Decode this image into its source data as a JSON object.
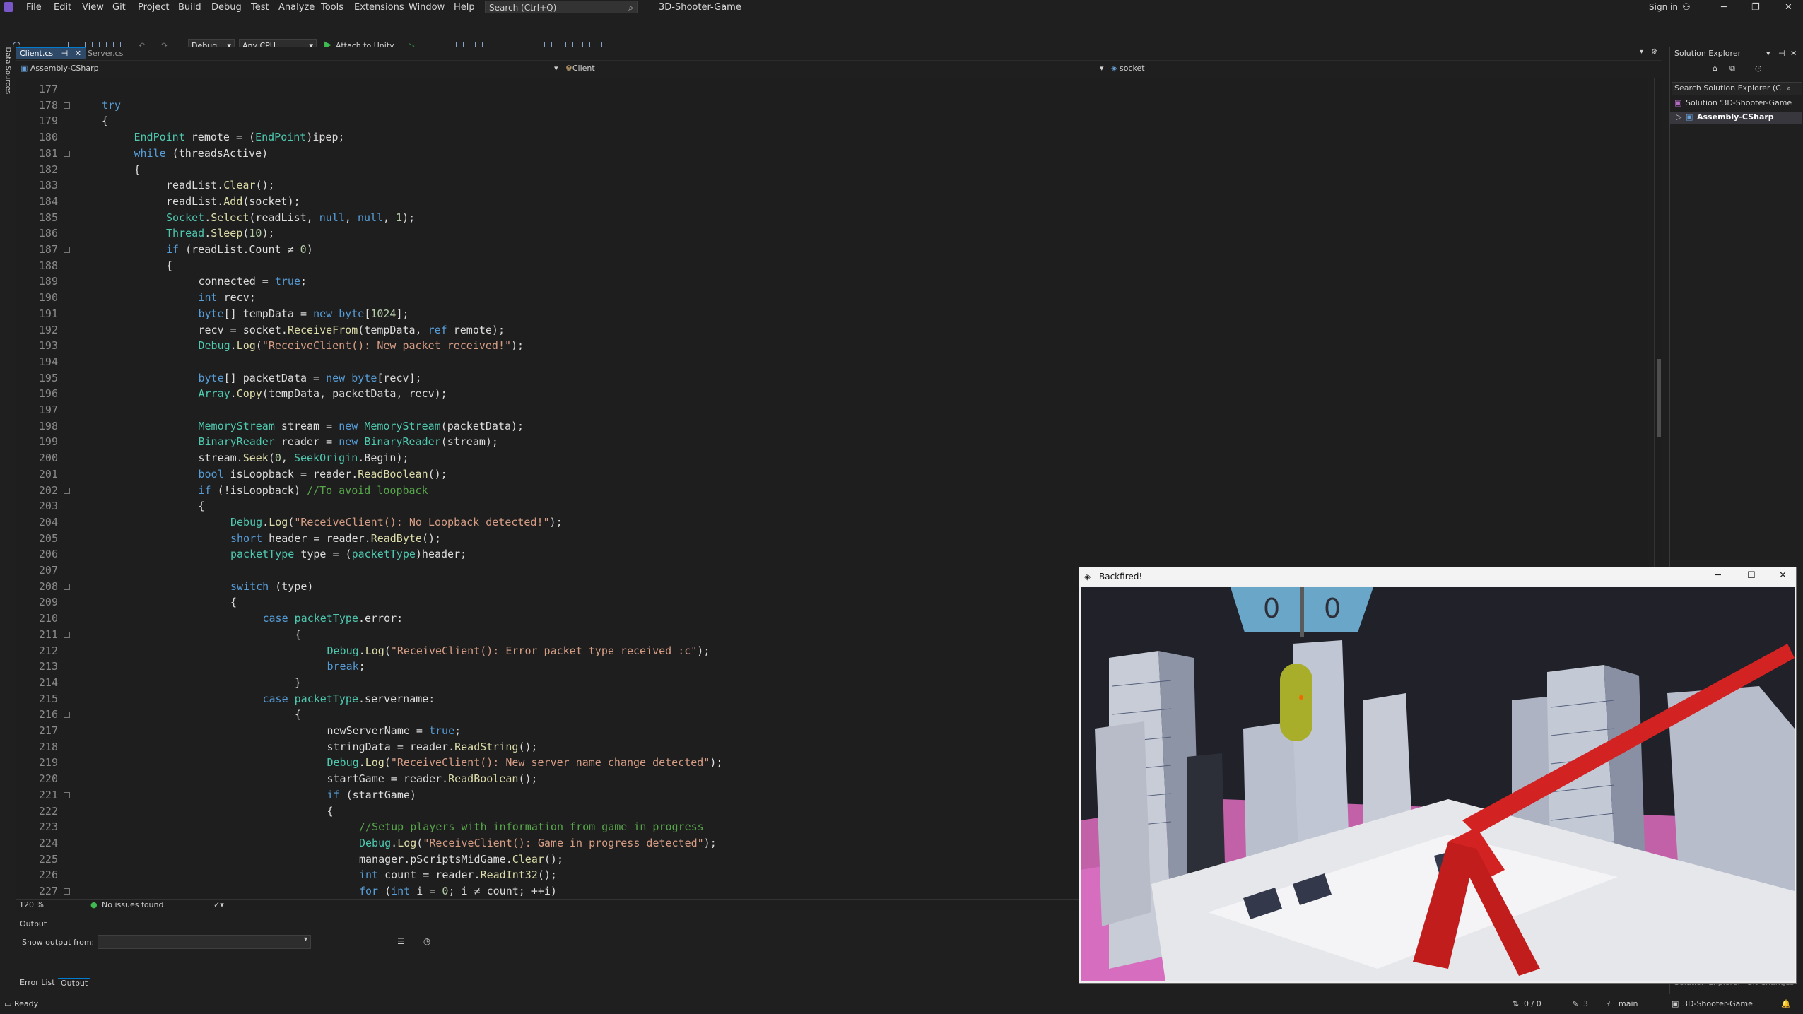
{
  "menu": {
    "items": [
      "File",
      "Edit",
      "View",
      "Git",
      "Project",
      "Build",
      "Debug",
      "Test",
      "Analyze",
      "Tools",
      "Extensions",
      "Window",
      "Help"
    ],
    "search_placeholder": "Search (Ctrl+Q)",
    "solution_title": "3D-Shooter-Game",
    "sign_in": "Sign in"
  },
  "toolbar": {
    "config": "Debug",
    "platform": "Any CPU",
    "attach": "Attach to Unity"
  },
  "tabs": [
    {
      "label": "Client.cs"
    },
    {
      "label": "Server.cs"
    }
  ],
  "navbar": {
    "project": "Assembly-CSharp",
    "class": "Client",
    "member": "socket"
  },
  "left_strip": {
    "label": "Data Sources"
  },
  "editor": {
    "zoom": "120 %",
    "issues": "No issues found",
    "lines": [
      {
        "n": "177",
        "indent": 0,
        "parts": []
      },
      {
        "n": "178",
        "indent": 2,
        "parts": [
          [
            "kw",
            "try"
          ]
        ]
      },
      {
        "n": "179",
        "indent": 2,
        "parts": [
          [
            "",
            "{"
          ]
        ]
      },
      {
        "n": "180",
        "indent": 3,
        "parts": [
          [
            "ty",
            "EndPoint"
          ],
          [
            "",
            " remote = ("
          ],
          [
            "ty",
            "EndPoint"
          ],
          [
            "",
            ")ipep;"
          ]
        ]
      },
      {
        "n": "181",
        "indent": 3,
        "parts": [
          [
            "kw",
            "while"
          ],
          [
            "",
            " (threadsActive)"
          ]
        ]
      },
      {
        "n": "182",
        "indent": 3,
        "parts": [
          [
            "",
            "{"
          ]
        ]
      },
      {
        "n": "183",
        "indent": 4,
        "parts": [
          [
            "",
            "readList."
          ],
          [
            "mt",
            "Clear"
          ],
          [
            "",
            "();"
          ]
        ]
      },
      {
        "n": "184",
        "indent": 4,
        "parts": [
          [
            "",
            "readList."
          ],
          [
            "mt",
            "Add"
          ],
          [
            "",
            "(socket);"
          ]
        ]
      },
      {
        "n": "185",
        "indent": 4,
        "parts": [
          [
            "ty",
            "Socket"
          ],
          [
            "",
            "."
          ],
          [
            "mt",
            "Select"
          ],
          [
            "",
            "(readList, "
          ],
          [
            "kw",
            "null"
          ],
          [
            "",
            ", "
          ],
          [
            "kw",
            "null"
          ],
          [
            "",
            ", "
          ],
          [
            "nm",
            "1"
          ],
          [
            "",
            ");"
          ]
        ]
      },
      {
        "n": "186",
        "indent": 4,
        "parts": [
          [
            "ty",
            "Thread"
          ],
          [
            "",
            "."
          ],
          [
            "mt",
            "Sleep"
          ],
          [
            "",
            "("
          ],
          [
            "nm",
            "10"
          ],
          [
            "",
            ");"
          ]
        ]
      },
      {
        "n": "187",
        "indent": 4,
        "parts": [
          [
            "kw",
            "if"
          ],
          [
            "",
            " (readList.Count ≠ "
          ],
          [
            "nm",
            "0"
          ],
          [
            "",
            ")"
          ]
        ]
      },
      {
        "n": "188",
        "indent": 4,
        "parts": [
          [
            "",
            "{"
          ]
        ]
      },
      {
        "n": "189",
        "indent": 5,
        "parts": [
          [
            "",
            "connected = "
          ],
          [
            "kw",
            "true"
          ],
          [
            "",
            ";"
          ]
        ]
      },
      {
        "n": "190",
        "indent": 5,
        "parts": [
          [
            "kw",
            "int"
          ],
          [
            "",
            " recv;"
          ]
        ]
      },
      {
        "n": "191",
        "indent": 5,
        "parts": [
          [
            "kw",
            "byte"
          ],
          [
            "",
            "[] tempData = "
          ],
          [
            "kw",
            "new"
          ],
          [
            "",
            " "
          ],
          [
            "kw",
            "byte"
          ],
          [
            "",
            "["
          ],
          [
            "nm",
            "1024"
          ],
          [
            "",
            "];"
          ]
        ]
      },
      {
        "n": "192",
        "indent": 5,
        "parts": [
          [
            "",
            "recv = socket."
          ],
          [
            "mt",
            "ReceiveFrom"
          ],
          [
            "",
            "(tempData, "
          ],
          [
            "kw",
            "ref"
          ],
          [
            "",
            " remote);"
          ]
        ]
      },
      {
        "n": "193",
        "indent": 5,
        "parts": [
          [
            "ty",
            "Debug"
          ],
          [
            "",
            "."
          ],
          [
            "mt",
            "Log"
          ],
          [
            "",
            "("
          ],
          [
            "st",
            "\"ReceiveClient(): New packet received!\""
          ],
          [
            "",
            ");"
          ]
        ]
      },
      {
        "n": "194",
        "indent": 0,
        "parts": []
      },
      {
        "n": "195",
        "indent": 5,
        "parts": [
          [
            "kw",
            "byte"
          ],
          [
            "",
            "[] packetData = "
          ],
          [
            "kw",
            "new"
          ],
          [
            "",
            " "
          ],
          [
            "kw",
            "byte"
          ],
          [
            "",
            "[recv];"
          ]
        ]
      },
      {
        "n": "196",
        "indent": 5,
        "parts": [
          [
            "ty",
            "Array"
          ],
          [
            "",
            "."
          ],
          [
            "mt",
            "Copy"
          ],
          [
            "",
            "(tempData, packetData, recv);"
          ]
        ]
      },
      {
        "n": "197",
        "indent": 0,
        "parts": []
      },
      {
        "n": "198",
        "indent": 5,
        "parts": [
          [
            "ty",
            "MemoryStream"
          ],
          [
            "",
            " stream = "
          ],
          [
            "kw",
            "new"
          ],
          [
            "",
            " "
          ],
          [
            "ty",
            "MemoryStream"
          ],
          [
            "",
            "(packetData);"
          ]
        ]
      },
      {
        "n": "199",
        "indent": 5,
        "parts": [
          [
            "ty",
            "BinaryReader"
          ],
          [
            "",
            " reader = "
          ],
          [
            "kw",
            "new"
          ],
          [
            "",
            " "
          ],
          [
            "ty",
            "BinaryReader"
          ],
          [
            "",
            "(stream);"
          ]
        ]
      },
      {
        "n": "200",
        "indent": 5,
        "parts": [
          [
            "",
            "stream."
          ],
          [
            "mt",
            "Seek"
          ],
          [
            "",
            "("
          ],
          [
            "nm",
            "0"
          ],
          [
            "",
            ", "
          ],
          [
            "ty",
            "SeekOrigin"
          ],
          [
            "",
            ".Begin);"
          ]
        ]
      },
      {
        "n": "201",
        "indent": 5,
        "parts": [
          [
            "kw",
            "bool"
          ],
          [
            "",
            " isLoopback = reader."
          ],
          [
            "mt",
            "ReadBoolean"
          ],
          [
            "",
            "();"
          ]
        ]
      },
      {
        "n": "202",
        "indent": 5,
        "parts": [
          [
            "kw",
            "if"
          ],
          [
            "",
            " (!isLoopback) "
          ],
          [
            "cm",
            "//To avoid loopback"
          ]
        ]
      },
      {
        "n": "203",
        "indent": 5,
        "parts": [
          [
            "",
            "{"
          ]
        ]
      },
      {
        "n": "204",
        "indent": 6,
        "parts": [
          [
            "ty",
            "Debug"
          ],
          [
            "",
            "."
          ],
          [
            "mt",
            "Log"
          ],
          [
            "",
            "("
          ],
          [
            "st",
            "\"ReceiveClient(): No Loopback detected!\""
          ],
          [
            "",
            ");"
          ]
        ]
      },
      {
        "n": "205",
        "indent": 6,
        "parts": [
          [
            "kw",
            "short"
          ],
          [
            "",
            " header = reader."
          ],
          [
            "mt",
            "ReadByte"
          ],
          [
            "",
            "();"
          ]
        ]
      },
      {
        "n": "206",
        "indent": 6,
        "parts": [
          [
            "ty",
            "packetType"
          ],
          [
            "",
            " type = ("
          ],
          [
            "ty",
            "packetType"
          ],
          [
            "",
            ")header;"
          ]
        ]
      },
      {
        "n": "207",
        "indent": 0,
        "parts": []
      },
      {
        "n": "208",
        "indent": 6,
        "parts": [
          [
            "kw",
            "switch"
          ],
          [
            "",
            " (type)"
          ]
        ]
      },
      {
        "n": "209",
        "indent": 6,
        "parts": [
          [
            "",
            "{"
          ]
        ]
      },
      {
        "n": "210",
        "indent": 7,
        "parts": [
          [
            "kw",
            "case"
          ],
          [
            "",
            " "
          ],
          [
            "ty",
            "packetType"
          ],
          [
            "",
            ".error:"
          ]
        ]
      },
      {
        "n": "211",
        "indent": 8,
        "parts": [
          [
            "",
            "{"
          ]
        ]
      },
      {
        "n": "212",
        "indent": 9,
        "parts": [
          [
            "ty",
            "Debug"
          ],
          [
            "",
            "."
          ],
          [
            "mt",
            "Log"
          ],
          [
            "",
            "("
          ],
          [
            "st",
            "\"ReceiveClient(): Error packet type received :c\""
          ],
          [
            "",
            ");"
          ]
        ]
      },
      {
        "n": "213",
        "indent": 9,
        "parts": [
          [
            "kw",
            "break"
          ],
          [
            "",
            ";"
          ]
        ]
      },
      {
        "n": "214",
        "indent": 8,
        "parts": [
          [
            "",
            "}"
          ]
        ]
      },
      {
        "n": "215",
        "indent": 7,
        "parts": [
          [
            "kw",
            "case"
          ],
          [
            "",
            " "
          ],
          [
            "ty",
            "packetType"
          ],
          [
            "",
            ".servername:"
          ]
        ]
      },
      {
        "n": "216",
        "indent": 8,
        "parts": [
          [
            "",
            "{"
          ]
        ]
      },
      {
        "n": "217",
        "indent": 9,
        "parts": [
          [
            "",
            "newServerName = "
          ],
          [
            "kw",
            "true"
          ],
          [
            "",
            ";"
          ]
        ]
      },
      {
        "n": "218",
        "indent": 9,
        "parts": [
          [
            "",
            "stringData = reader."
          ],
          [
            "mt",
            "ReadString"
          ],
          [
            "",
            "();"
          ]
        ]
      },
      {
        "n": "219",
        "indent": 9,
        "parts": [
          [
            "ty",
            "Debug"
          ],
          [
            "",
            "."
          ],
          [
            "mt",
            "Log"
          ],
          [
            "",
            "("
          ],
          [
            "st",
            "\"ReceiveClient(): New server name change detected\""
          ],
          [
            "",
            ");"
          ]
        ]
      },
      {
        "n": "220",
        "indent": 9,
        "parts": [
          [
            "",
            "startGame = reader."
          ],
          [
            "mt",
            "ReadBoolean"
          ],
          [
            "",
            "();"
          ]
        ]
      },
      {
        "n": "221",
        "indent": 9,
        "parts": [
          [
            "kw",
            "if"
          ],
          [
            "",
            " (startGame)"
          ]
        ]
      },
      {
        "n": "222",
        "indent": 9,
        "parts": [
          [
            "",
            "{"
          ]
        ]
      },
      {
        "n": "223",
        "indent": 10,
        "parts": [
          [
            "cm",
            "//Setup players with information from game in progress"
          ]
        ]
      },
      {
        "n": "224",
        "indent": 10,
        "parts": [
          [
            "ty",
            "Debug"
          ],
          [
            "",
            "."
          ],
          [
            "mt",
            "Log"
          ],
          [
            "",
            "("
          ],
          [
            "st",
            "\"ReceiveClient(): Game in progress detected\""
          ],
          [
            "",
            ");"
          ]
        ]
      },
      {
        "n": "225",
        "indent": 10,
        "parts": [
          [
            "",
            "manager.pScriptsMidGame."
          ],
          [
            "mt",
            "Clear"
          ],
          [
            "",
            "();"
          ]
        ]
      },
      {
        "n": "226",
        "indent": 10,
        "parts": [
          [
            "kw",
            "int"
          ],
          [
            "",
            " count = reader."
          ],
          [
            "mt",
            "ReadInt32"
          ],
          [
            "",
            "();"
          ]
        ]
      },
      {
        "n": "227",
        "indent": 10,
        "parts": [
          [
            "kw",
            "for"
          ],
          [
            "",
            " ("
          ],
          [
            "kw",
            "int"
          ],
          [
            "",
            " i = "
          ],
          [
            "nm",
            "0"
          ],
          [
            "",
            "; i ≠ count; ++i)"
          ]
        ]
      }
    ]
  },
  "output": {
    "title": "Output",
    "show_from": "Show output from:",
    "tabs": [
      "Error List",
      "Output"
    ]
  },
  "solution_explorer": {
    "title": "Solution Explorer",
    "search": "Search Solution Explorer (C",
    "solution": "Solution '3D-Shooter-Game",
    "project": "Assembly-CSharp",
    "bottom_tabs": [
      "Solution Explorer",
      "Git Changes"
    ]
  },
  "status": {
    "ready": "Ready",
    "lines": "0 / 0",
    "edits": "3",
    "branch": "main",
    "repo": "3D-Shooter-Game"
  },
  "game": {
    "title": "Backfired!",
    "score_left": "0",
    "score_right": "0"
  },
  "colors": {
    "keyword": "#569cd6",
    "type": "#4ec9b0",
    "string": "#d69d85",
    "comment": "#57a64a",
    "accent": "#007acc"
  }
}
